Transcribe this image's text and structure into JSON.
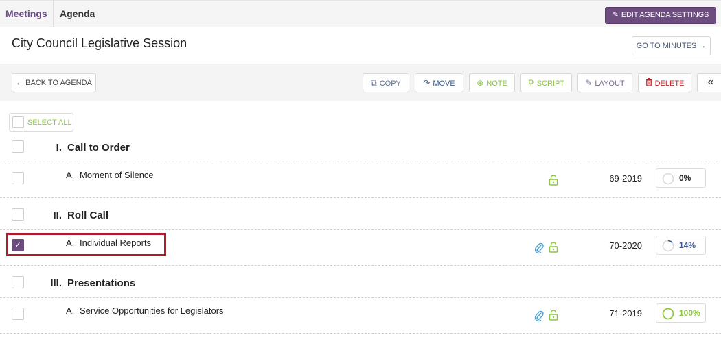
{
  "nav": {
    "tab_meetings": "Meetings",
    "tab_agenda": "Agenda",
    "edit_settings_label": "EDIT AGENDA SETTINGS"
  },
  "header": {
    "title": "City Council Legislative Session",
    "goto_minutes_label": "GO TO MINUTES →"
  },
  "toolbar": {
    "back_label": "← BACK TO AGENDA",
    "copy_label": "COPY",
    "move_label": "MOVE",
    "note_label": "NOTE",
    "script_label": "SCRIPT",
    "layout_label": "LAYOUT",
    "delete_label": "DELETE",
    "collapse_label": "«"
  },
  "select_all_label": "SELECT ALL",
  "sections": [
    {
      "number": "I.",
      "title": "Call to Order",
      "items": [
        {
          "letter": "A.",
          "title": "Moment of Silence",
          "code": "69-2019",
          "progress": "0%",
          "progress_value": 0,
          "checked": false,
          "attachment": false
        }
      ]
    },
    {
      "number": "II.",
      "title": "Roll Call",
      "items": [
        {
          "letter": "A.",
          "title": "Individual Reports",
          "code": "70-2020",
          "progress": "14%",
          "progress_value": 0.14,
          "checked": true,
          "attachment": true
        }
      ]
    },
    {
      "number": "III.",
      "title": "Presentations",
      "items": [
        {
          "letter": "A.",
          "title": "Service Opportunities for Legislators",
          "code": "71-2019",
          "progress": "100%",
          "progress_value": 1.0,
          "checked": false,
          "attachment": true
        }
      ]
    }
  ],
  "colors": {
    "brand_purple": "#6d4d7f",
    "accent_green": "#8cc63e",
    "delete_red": "#c0272d",
    "progress_blue": "#3a5aa0",
    "highlight_red": "#b4182d"
  }
}
